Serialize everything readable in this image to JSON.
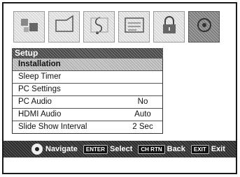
{
  "icon_bar": {
    "icons": [
      {
        "name": "picture-icon"
      },
      {
        "name": "screen-icon"
      },
      {
        "name": "audio-icon"
      },
      {
        "name": "ch-list-icon"
      },
      {
        "name": "lock-icon"
      },
      {
        "name": "setup-icon"
      }
    ],
    "active_index": 5
  },
  "menu": {
    "title": "Setup",
    "items": [
      {
        "label": "Installation",
        "value": ""
      },
      {
        "label": "Sleep Timer",
        "value": ""
      },
      {
        "label": "PC Settings",
        "value": ""
      },
      {
        "label": "PC Audio",
        "value": "No"
      },
      {
        "label": "HDMI Audio",
        "value": "Auto"
      },
      {
        "label": "Slide Show Interval",
        "value": "2 Sec"
      }
    ],
    "selected_index": 0
  },
  "footer": {
    "navigate_label": "Navigate",
    "enter_key": "ENTER",
    "select_label": "Select",
    "chrtn_key": "CH RTN",
    "back_label": "Back",
    "exit_key": "EXIT",
    "exit_label": "Exit"
  }
}
